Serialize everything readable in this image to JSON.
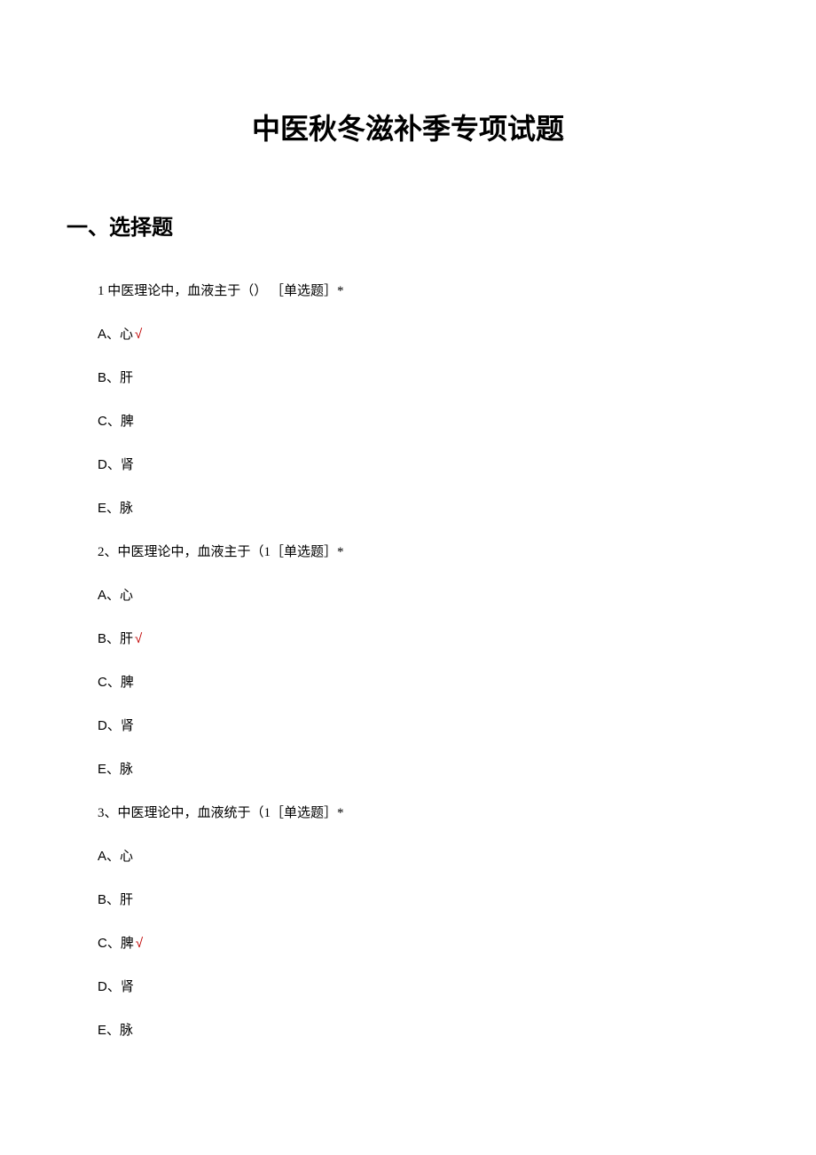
{
  "title": "中医秋冬滋补季专项试题",
  "section_heading": "一、选择题",
  "questions": [
    {
      "text": "1 中医理论中，血液主于（） ［单选题］*",
      "options": [
        {
          "label": "A、",
          "text": "心",
          "correct": true
        },
        {
          "label": "B、",
          "text": "肝",
          "correct": false
        },
        {
          "label": "C、",
          "text": "脾",
          "correct": false
        },
        {
          "label": "D、",
          "text": "肾",
          "correct": false
        },
        {
          "label": "E、",
          "text": "脉",
          "correct": false
        }
      ]
    },
    {
      "text": "2、中医理论中，血液主于（1［单选题］*",
      "options": [
        {
          "label": "A、",
          "text": "心",
          "correct": false
        },
        {
          "label": "B、",
          "text": "肝",
          "correct": true
        },
        {
          "label": "C、",
          "text": "脾",
          "correct": false
        },
        {
          "label": "D、",
          "text": "肾",
          "correct": false
        },
        {
          "label": "E、",
          "text": "脉",
          "correct": false
        }
      ]
    },
    {
      "text": "3、中医理论中，血液统于（1［单选题］*",
      "options": [
        {
          "label": "A、",
          "text": "心",
          "correct": false
        },
        {
          "label": "B、",
          "text": "肝",
          "correct": false
        },
        {
          "label": "C、",
          "text": "脾",
          "correct": true
        },
        {
          "label": "D、",
          "text": "肾",
          "correct": false
        },
        {
          "label": "E、",
          "text": "脉",
          "correct": false
        }
      ]
    }
  ],
  "check_mark": "√"
}
